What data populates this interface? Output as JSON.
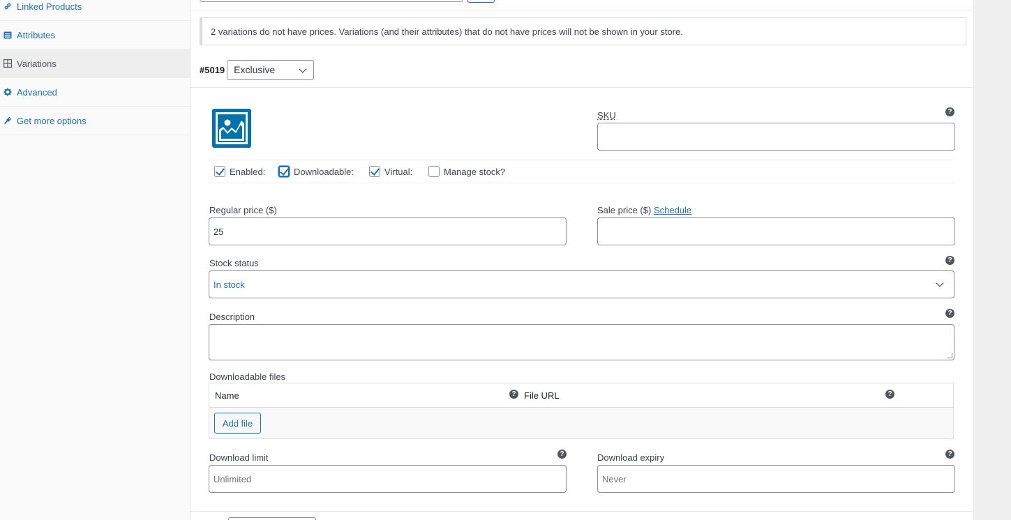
{
  "sidebar": {
    "items": [
      {
        "label": "Linked Products",
        "icon": "link-icon"
      },
      {
        "label": "Attributes",
        "icon": "attributes-icon"
      },
      {
        "label": "Variations",
        "icon": "grid-icon"
      },
      {
        "label": "Advanced",
        "icon": "gear-icon"
      },
      {
        "label": "Get more options",
        "icon": "plug-icon"
      }
    ]
  },
  "notice": {
    "text": "2 variations do not have prices. Variations (and their attributes) that do not have prices will not be shown in your store."
  },
  "variation": {
    "id": "#5019",
    "selected_attribute": "Exclusive",
    "sku_label": "SKU",
    "sku_value": "",
    "options": {
      "enabled_label": "Enabled:",
      "enabled": true,
      "downloadable_label": "Downloadable:",
      "downloadable": true,
      "virtual_label": "Virtual:",
      "virtual": true,
      "manage_stock_label": "Manage stock?",
      "manage_stock": false
    },
    "regular_price_label": "Regular price ($)",
    "regular_price_value": "25",
    "sale_price_label": "Sale price ($)",
    "sale_price_link": "Schedule",
    "sale_price_value": "",
    "stock_status_label": "Stock status",
    "stock_status_value": "In stock",
    "description_label": "Description",
    "description_value": "",
    "downloadable_files_label": "Downloadable files",
    "files_columns": {
      "name": "Name",
      "file_url": "File URL"
    },
    "add_file_label": "Add file",
    "download_limit_label": "Download limit",
    "download_limit_placeholder": "Unlimited",
    "download_expiry_label": "Download expiry",
    "download_expiry_placeholder": "Never"
  },
  "colors": {
    "accent": "#2271b1",
    "sidebar_bg": "#fafafa",
    "active_item_bg": "#eeeeee",
    "help_icon": "#50575e"
  }
}
